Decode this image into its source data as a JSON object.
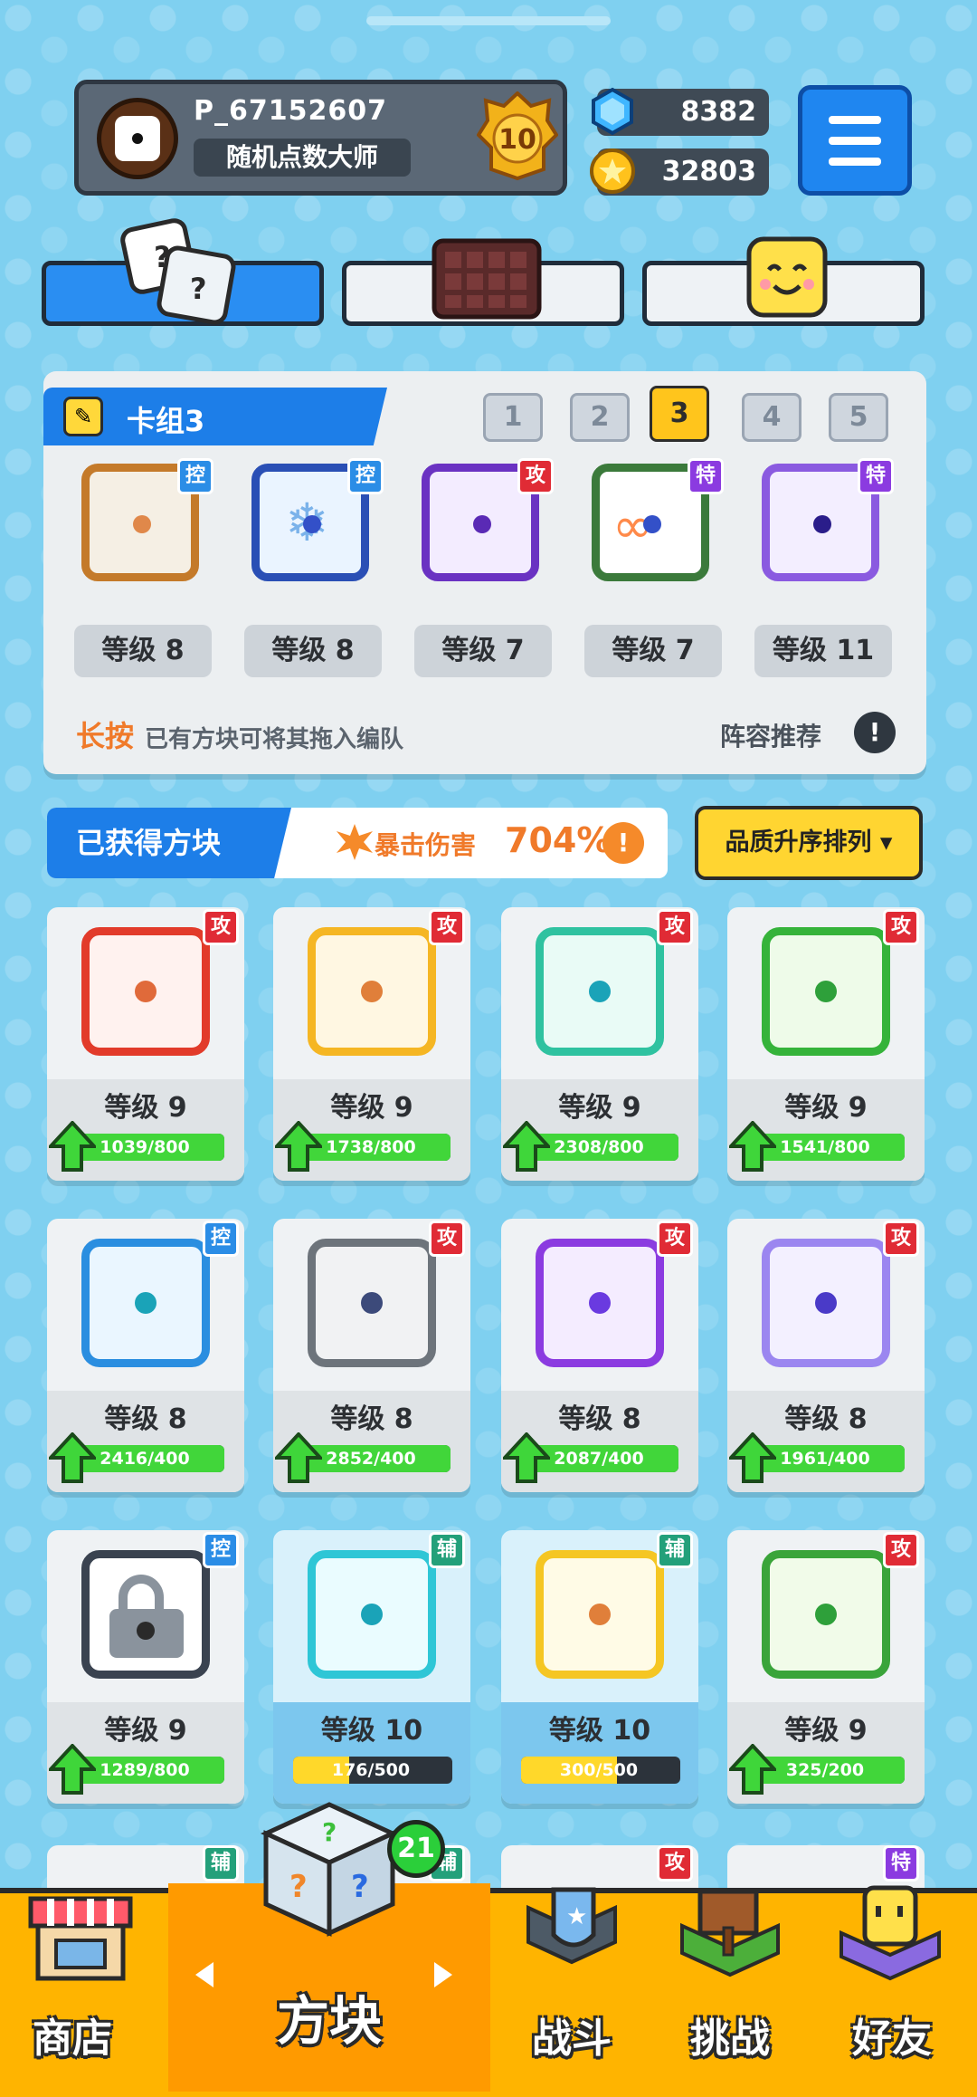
{
  "player": {
    "name": "P_67152607",
    "title": "随机点数大师",
    "rank": "10"
  },
  "currency": {
    "gems": "8382",
    "coins": "32803"
  },
  "deck": {
    "title": "卡组3",
    "tabs": [
      "1",
      "2",
      "3",
      "4",
      "5"
    ],
    "active_tab": "3",
    "slots": [
      {
        "badge": "控",
        "level": "等级 8"
      },
      {
        "badge": "控",
        "level": "等级 8"
      },
      {
        "badge": "攻",
        "level": "等级 7"
      },
      {
        "badge": "特",
        "level": "等级 7"
      },
      {
        "badge": "特",
        "level": "等级 11"
      }
    ],
    "hint_key": "长按",
    "hint_text": "已有方块可将其拖入编队",
    "recommend": "阵容推荐"
  },
  "owned": {
    "title": "已获得方块",
    "crit_label": "暴击伤害",
    "crit_value": "704%",
    "sort_label": "品质升序排列"
  },
  "cards": [
    {
      "badge": "攻",
      "level": "等级 9",
      "progress": "1039/800",
      "fill": 1.0
    },
    {
      "badge": "攻",
      "level": "等级 9",
      "progress": "1738/800",
      "fill": 1.0
    },
    {
      "badge": "攻",
      "level": "等级 9",
      "progress": "2308/800",
      "fill": 1.0
    },
    {
      "badge": "攻",
      "level": "等级 9",
      "progress": "1541/800",
      "fill": 1.0
    },
    {
      "badge": "控",
      "level": "等级 8",
      "progress": "2416/400",
      "fill": 1.0
    },
    {
      "badge": "攻",
      "level": "等级 8",
      "progress": "2852/400",
      "fill": 1.0
    },
    {
      "badge": "攻",
      "level": "等级 8",
      "progress": "2087/400",
      "fill": 1.0
    },
    {
      "badge": "攻",
      "level": "等级 8",
      "progress": "1961/400",
      "fill": 1.0
    },
    {
      "badge": "控",
      "level": "等级 9",
      "progress": "1289/800",
      "fill": 1.0
    },
    {
      "badge": "辅",
      "level": "等级 10",
      "progress": "176/500",
      "fill": 0.35
    },
    {
      "badge": "辅",
      "level": "等级 10",
      "progress": "300/500",
      "fill": 0.6
    },
    {
      "badge": "攻",
      "level": "等级 9",
      "progress": "325/200",
      "fill": 1.0
    }
  ],
  "partial_row_badges": [
    "辅",
    "辅",
    "攻",
    "特"
  ],
  "nav": {
    "shop": "商店",
    "blocks": "方块",
    "battle": "战斗",
    "challenge": "挑战",
    "friends": "好友",
    "blocks_badge": "21"
  }
}
